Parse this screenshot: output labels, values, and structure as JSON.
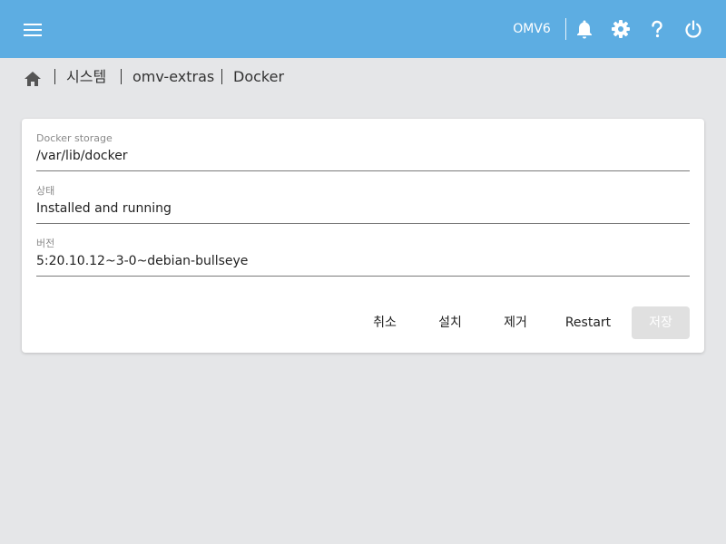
{
  "header": {
    "hostname": "OMV6",
    "icons": [
      "menu-icon",
      "bell-icon",
      "gear-icon",
      "help-icon",
      "power-icon"
    ],
    "background_color": "#5dade2"
  },
  "breadcrumb": {
    "home_icon": "home-icon",
    "items": [
      "시스템",
      "omv-extras",
      "Docker"
    ]
  },
  "form": {
    "fields": [
      {
        "label": "Docker storage",
        "value": "/var/lib/docker"
      },
      {
        "label": "상태",
        "value": "Installed and running"
      },
      {
        "label": "버전",
        "value": "5:20.10.12~3-0~debian-bullseye"
      }
    ],
    "actions": {
      "cancel": "취소",
      "install": "설치",
      "remove": "제거",
      "restart": "Restart",
      "save": "저장"
    },
    "save_disabled": true
  }
}
